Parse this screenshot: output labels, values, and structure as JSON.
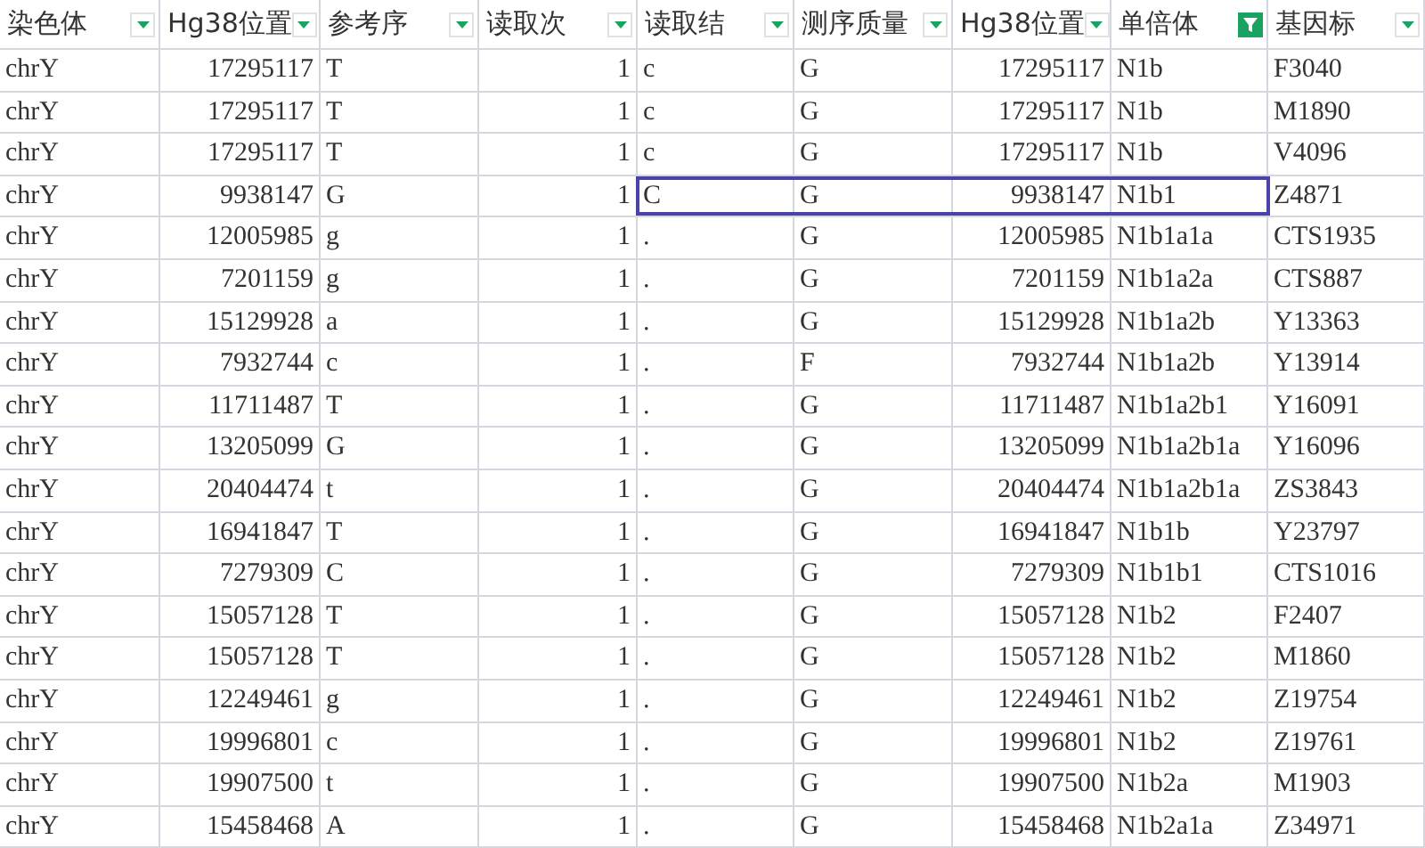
{
  "columns": [
    {
      "label": "染色体",
      "filtered": false
    },
    {
      "label": "Hg38位置",
      "filtered": false
    },
    {
      "label": "参考序",
      "filtered": false
    },
    {
      "label": "读取次",
      "filtered": false
    },
    {
      "label": "读取结",
      "filtered": false
    },
    {
      "label": "测序质量",
      "filtered": false
    },
    {
      "label": "Hg38位置",
      "filtered": false
    },
    {
      "label": "单倍体",
      "filtered": true
    },
    {
      "label": "基因标",
      "filtered": false
    }
  ],
  "rows": [
    {
      "cells": [
        "chrY",
        "17295117",
        "T",
        "1",
        "c",
        "G",
        "17295117",
        "N1b",
        "F3040"
      ],
      "selected": false
    },
    {
      "cells": [
        "chrY",
        "17295117",
        "T",
        "1",
        "c",
        "G",
        "17295117",
        "N1b",
        "M1890"
      ],
      "selected": false
    },
    {
      "cells": [
        "chrY",
        "17295117",
        "T",
        "1",
        "c",
        "G",
        "17295117",
        "N1b",
        "V4096"
      ],
      "selected": false
    },
    {
      "cells": [
        "chrY",
        "9938147",
        "G",
        "1",
        "C",
        "G",
        "9938147",
        "N1b1",
        "Z4871"
      ],
      "selected": true
    },
    {
      "cells": [
        "chrY",
        "12005985",
        "g",
        "1",
        ".",
        "G",
        "12005985",
        "N1b1a1a",
        "CTS1935"
      ],
      "selected": false
    },
    {
      "cells": [
        "chrY",
        "7201159",
        "g",
        "1",
        ".",
        "G",
        "7201159",
        "N1b1a2a",
        "CTS887"
      ],
      "selected": false
    },
    {
      "cells": [
        "chrY",
        "15129928",
        "a",
        "1",
        ".",
        "G",
        "15129928",
        "N1b1a2b",
        "Y13363"
      ],
      "selected": false
    },
    {
      "cells": [
        "chrY",
        "7932744",
        "c",
        "1",
        ".",
        "F",
        "7932744",
        "N1b1a2b",
        "Y13914"
      ],
      "selected": false
    },
    {
      "cells": [
        "chrY",
        "11711487",
        "T",
        "1",
        ".",
        "G",
        "11711487",
        "N1b1a2b1",
        "Y16091"
      ],
      "selected": false
    },
    {
      "cells": [
        "chrY",
        "13205099",
        "G",
        "1",
        ".",
        "G",
        "13205099",
        "N1b1a2b1a",
        "Y16096"
      ],
      "selected": false
    },
    {
      "cells": [
        "chrY",
        "20404474",
        "t",
        "1",
        ".",
        "G",
        "20404474",
        "N1b1a2b1a",
        "ZS3843"
      ],
      "selected": false
    },
    {
      "cells": [
        "chrY",
        "16941847",
        "T",
        "1",
        ".",
        "G",
        "16941847",
        "N1b1b",
        "Y23797"
      ],
      "selected": false
    },
    {
      "cells": [
        "chrY",
        "7279309",
        "C",
        "1",
        ".",
        "G",
        "7279309",
        "N1b1b1",
        "CTS1016"
      ],
      "selected": false
    },
    {
      "cells": [
        "chrY",
        "15057128",
        "T",
        "1",
        ".",
        "G",
        "15057128",
        "N1b2",
        "F2407"
      ],
      "selected": false
    },
    {
      "cells": [
        "chrY",
        "15057128",
        "T",
        "1",
        ".",
        "G",
        "15057128",
        "N1b2",
        "M1860"
      ],
      "selected": false
    },
    {
      "cells": [
        "chrY",
        "12249461",
        "g",
        "1",
        ".",
        "G",
        "12249461",
        "N1b2",
        "Z19754"
      ],
      "selected": false
    },
    {
      "cells": [
        "chrY",
        "19996801",
        "c",
        "1",
        ".",
        "G",
        "19996801",
        "N1b2",
        "Z19761"
      ],
      "selected": false
    },
    {
      "cells": [
        "chrY",
        "19907500",
        "t",
        "1",
        ".",
        "G",
        "19907500",
        "N1b2a",
        "M1903"
      ],
      "selected": false
    },
    {
      "cells": [
        "chrY",
        "15458468",
        "A",
        "1",
        ".",
        "G",
        "15458468",
        "N1b2a1a",
        "Z34971"
      ],
      "selected": false
    }
  ]
}
